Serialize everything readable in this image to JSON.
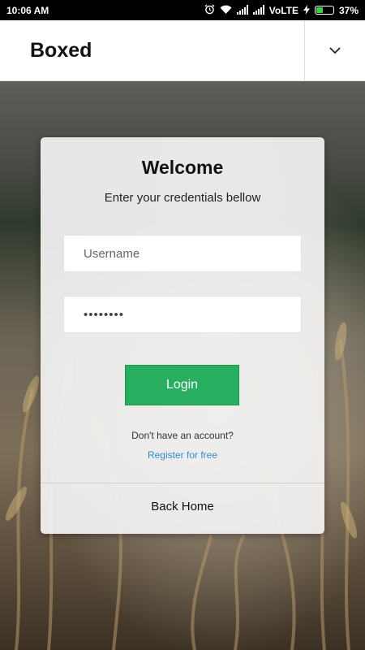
{
  "status_bar": {
    "time": "10:06 AM",
    "network": "VoLTE",
    "battery_percent": "37%",
    "battery_level": 0.37,
    "icons": [
      "alarm-icon",
      "wifi-icon",
      "signal-icon",
      "signal-icon",
      "charging-icon",
      "battery-icon"
    ]
  },
  "header": {
    "title": "Boxed",
    "menu_icon": "chevron-down-icon"
  },
  "login_card": {
    "title": "Welcome",
    "subtitle": "Enter your credentials bellow",
    "username_placeholder": "Username",
    "username_value": "",
    "password_value": "••••••••",
    "login_label": "Login",
    "no_account_text": "Don't have an account?",
    "register_label": "Register for free",
    "back_home_label": "Back Home"
  },
  "colors": {
    "accent_green": "#27ae60",
    "link_blue": "#2a8fd0"
  }
}
